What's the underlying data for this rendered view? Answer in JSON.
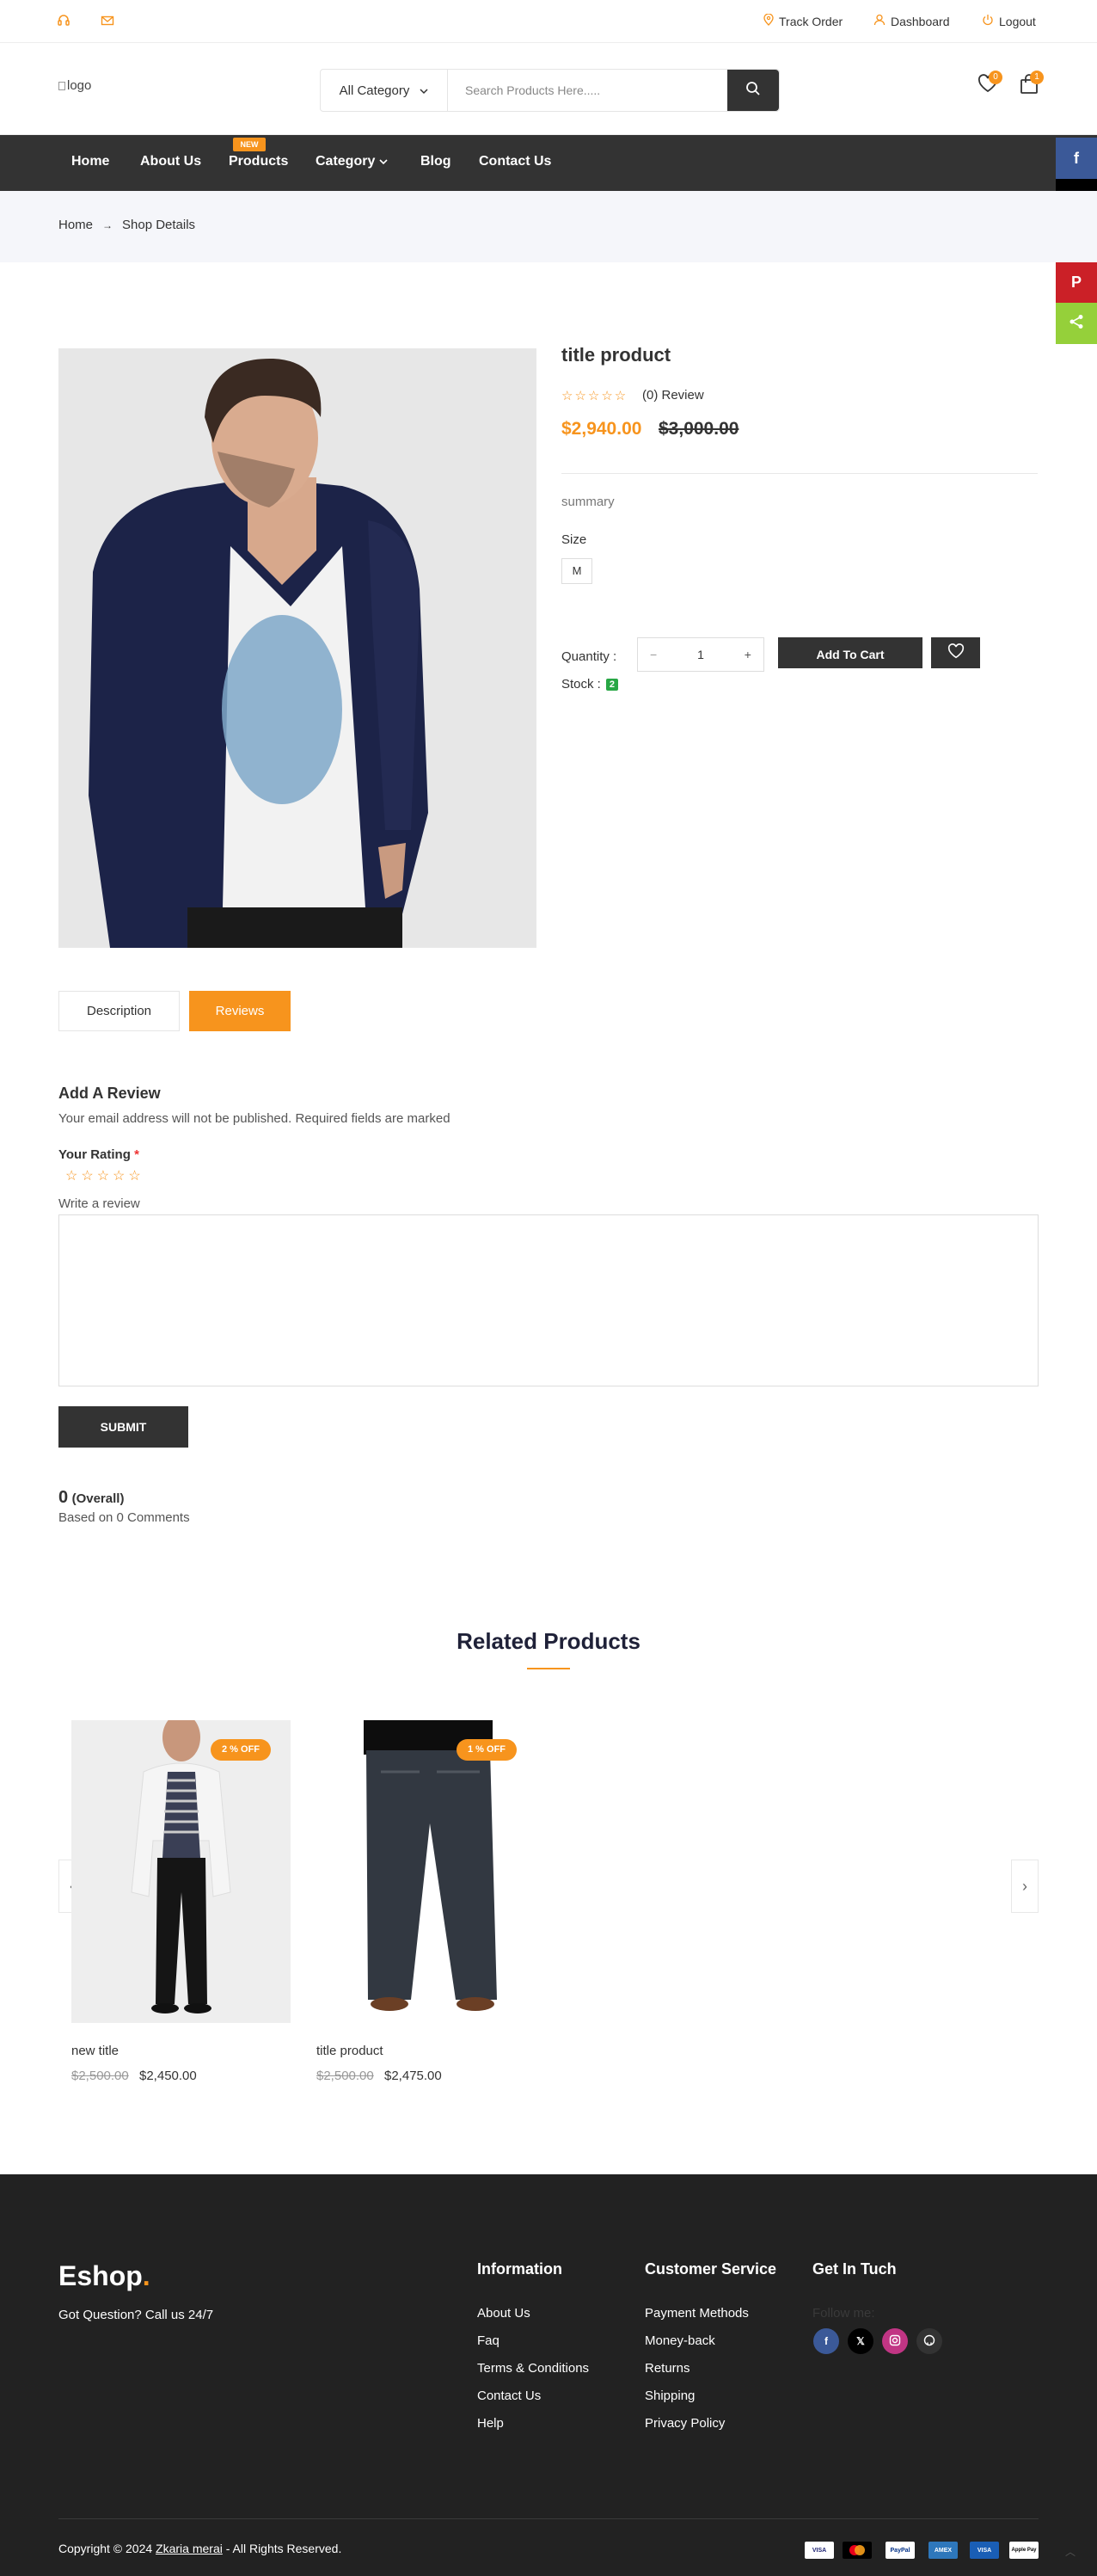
{
  "topbar": {
    "track": "Track Order",
    "dashboard": "Dashboard",
    "logout": "Logout"
  },
  "header": {
    "logo_alt": "logo",
    "category": "All Category",
    "search_placeholder": "Search Products Here.....",
    "wishlist_count": "0",
    "cart_count": "1"
  },
  "nav": {
    "items": [
      "Home",
      "About Us",
      "Products",
      "Category",
      "Blog",
      "Contact Us"
    ],
    "new_tag": "NEW"
  },
  "share": {
    "items": [
      "facebook-icon",
      "x-icon",
      "messenger-icon",
      "pinterest-icon",
      "share-icon"
    ],
    "colors": [
      "#3b5998",
      "#000000",
      "#448aff",
      "#cb2027",
      "#95d03a"
    ]
  },
  "breadcrumb": {
    "home": "Home",
    "current": "Shop Details"
  },
  "product": {
    "title": "title product",
    "reviews": "(0) Review",
    "price": "$2,940.00",
    "old_price": "$3,000.00",
    "summary": "summary",
    "size_label": "Size",
    "size": "M",
    "qty_label": "Quantity :",
    "qty": "1",
    "add_to_cart": "Add To Cart",
    "stock_label": "Stock :",
    "stock": "2"
  },
  "tabs": {
    "description": "Description",
    "reviews": "Reviews"
  },
  "review_form": {
    "title": "Add A Review",
    "note": "Your email address will not be published. Required fields are marked",
    "rating_label": "Your Rating",
    "required": "*",
    "write_label": "Write a review",
    "submit": "SUBMIT",
    "overall_value": "0",
    "overall_label": "(Overall)",
    "based_on": "Based on 0 Comments"
  },
  "related": {
    "title": "Related Products",
    "products": [
      {
        "name": "new title",
        "old_price": "$2,500.00",
        "price": "$2,450.00",
        "badge": "2 % OFF"
      },
      {
        "name": "title product",
        "old_price": "$2,500.00",
        "price": "$2,475.00",
        "badge": "1 % OFF"
      }
    ]
  },
  "footer": {
    "logo_main": "Eshop",
    "logo_dot": ".",
    "question": "Got Question? Call us 24/7",
    "info_title": "Information",
    "info_links": [
      "About Us",
      "Faq",
      "Terms & Conditions",
      "Contact Us",
      "Help"
    ],
    "service_title": "Customer Service",
    "service_links": [
      "Payment Methods",
      "Money-back",
      "Returns",
      "Shipping",
      "Privacy Policy"
    ],
    "contact_title": "Get In Tuch",
    "follow": "Follow me:",
    "copyright_pre": "Copyright © 2024",
    "copyright_name": "Zkaria merai",
    "copyright_post": "- All Rights Reserved.",
    "payments": [
      "VISA",
      "MC",
      "PayPal",
      "AMEX",
      "VISA",
      "Apple Pay"
    ]
  },
  "colors": {
    "accent": "#f7941d",
    "dark": "#333333",
    "footer": "#222222"
  }
}
